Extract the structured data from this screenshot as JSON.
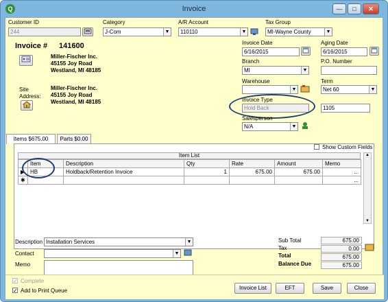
{
  "window": {
    "title": "Invoice",
    "app_icon": "Q",
    "min": "—",
    "max": "□",
    "close": "✕"
  },
  "customer": {
    "label": "Customer ID",
    "value": "244"
  },
  "category": {
    "label": "Category",
    "value": "J-Com"
  },
  "ar_account": {
    "label": "A/R Account",
    "value": "110110"
  },
  "tax_group": {
    "label": "Tax Group",
    "value": "MI-Wayne County"
  },
  "invoice": {
    "label": "Invoice #",
    "number": "141600"
  },
  "bill_to": {
    "line1": "Miller-Fischer Inc.",
    "line2": "45155 Joy Road",
    "line3": "Westland, MI  48185"
  },
  "site": {
    "label_line1": "Site",
    "label_line2": "Address:",
    "line1": "Miller-Fischer Inc.",
    "line2": "45155 Joy Road",
    "line3": "Westland, MI  48185"
  },
  "invoice_date": {
    "label": "Invoice Date",
    "value": "6/16/2015"
  },
  "aging_date": {
    "label": "Aging Date",
    "value": "6/16/2015"
  },
  "branch": {
    "label": "Branch",
    "value": "MI"
  },
  "po_number": {
    "label": "P.O. Number",
    "value": ""
  },
  "warehouse": {
    "label": "Warehouse",
    "value": ""
  },
  "term": {
    "label": "Term",
    "value": "Net 60"
  },
  "invoice_type": {
    "label": "Invoice Type",
    "value": "Hold Back",
    "extra_value": "1105"
  },
  "salesperson": {
    "label": "Salesperson",
    "value": "N/A"
  },
  "tabs": [
    {
      "label": "Items  $675.00"
    },
    {
      "label": "Parts  $0.00"
    }
  ],
  "show_custom_fields": "Show Custom Fields",
  "item_list": {
    "title": "Item List",
    "columns": [
      "Item",
      "Description",
      "Qty",
      "Rate",
      "Amount",
      "Memo"
    ],
    "rows": [
      {
        "item": "HB",
        "description": "Holdback/Retention Invoice",
        "qty": "1",
        "rate": "675.00",
        "amount": "675.00",
        "memo": "",
        "ellipsis": "..."
      }
    ],
    "new_row_marker": "✱",
    "new_row_ellipsis": "..."
  },
  "description": {
    "label": "Description",
    "value": "Installation Services"
  },
  "contact": {
    "label": "Contact",
    "value": ""
  },
  "memo": {
    "label": "Memo",
    "value": ""
  },
  "totals": {
    "subtotal_label": "Sub Total",
    "subtotal": "675.00",
    "tax_label": "Tax",
    "tax": "0.00",
    "total_label": "Total",
    "total": "675.00",
    "balance_label": "Balance Due",
    "balance": "675.00"
  },
  "footer": {
    "complete_label": "Complete",
    "print_queue_label": "Add to Print Queue",
    "invoice_list": "Invoice List",
    "eft": "EFT",
    "save": "Save",
    "close": "Close"
  },
  "colors": {
    "form_bg": "#ffffcc",
    "title_bg": "#7fb6de",
    "highlight": "#1e3f7a"
  }
}
